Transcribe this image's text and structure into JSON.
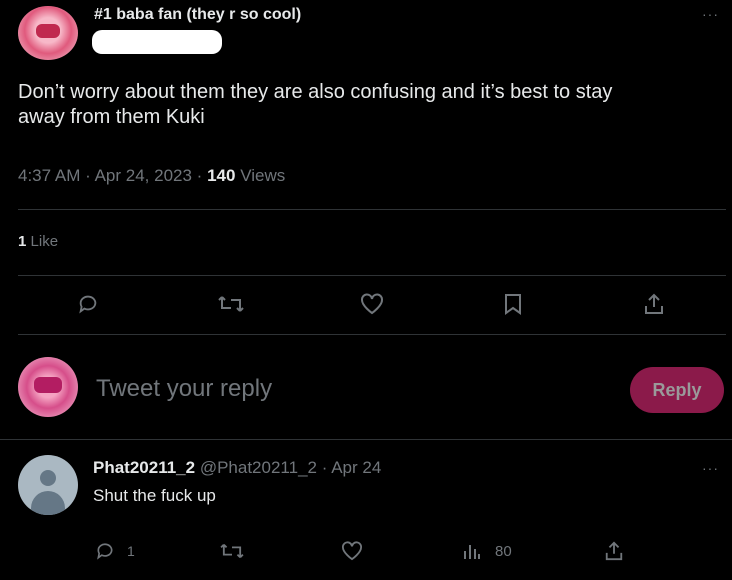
{
  "tweet": {
    "author_name": "#1 baba fan (they r so cool)",
    "body_line1": "Don’t worry about them they are also confusing and it’s best to stay",
    "body_line2": "away from them Kuki",
    "time": "4:37 AM",
    "date": "Apr 24, 2023",
    "sep": "·",
    "views_count": "140",
    "views_label": "Views",
    "likes_count": "1",
    "likes_label": "Like",
    "more": "···"
  },
  "reply_box": {
    "placeholder": "Tweet your reply",
    "button": "Reply"
  },
  "reply": {
    "name": "Phat20211_2",
    "handle": "@Phat20211_2",
    "sep": "·",
    "date": "Apr 24",
    "text": "Shut the fuck up",
    "reply_count": "1",
    "views_count": "80",
    "more": "···"
  },
  "colors": {
    "accent": "#8b1a4a",
    "background": "#000000",
    "muted": "#71767b"
  }
}
